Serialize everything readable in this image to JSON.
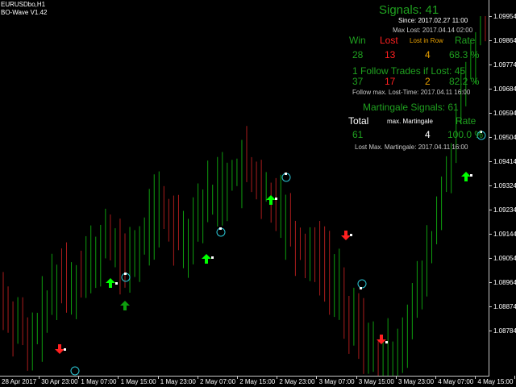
{
  "header": {
    "symbol": "EURUSDbo,H1",
    "indicator": "BO-Wave V1.42"
  },
  "price_axis": [
    "1.09954",
    "1.09864",
    "1.09774",
    "1.09684",
    "1.09594",
    "1.09504",
    "1.09414",
    "1.09324",
    "1.09234",
    "1.09144",
    "1.09054",
    "1.08964",
    "1.08874",
    "1.08784"
  ],
  "time_axis": [
    "28 Apr 2017",
    "30 Apr 23:00",
    "1 May 07:00",
    "1 May 15:00",
    "1 May 23:00",
    "2 May 07:00",
    "2 May 15:00",
    "2 May 23:00",
    "3 May 07:00",
    "3 May 15:00",
    "3 May 23:00",
    "4 May 07:00",
    "4 May 15:00"
  ],
  "stats": {
    "signals": "Signals: 41",
    "since": "Since: 2017.02.27 11:00",
    "max_lost": "Max Lost: 2017.04.14 02:00",
    "col_win": "Win",
    "col_lost": "Lost",
    "col_row": "Lost in Row",
    "col_rate": "Rate",
    "win": "28",
    "lost": "13",
    "row": "4",
    "rate": "68.3 %",
    "follow_title": "1 Follow Trades if Lost: 45",
    "f_win": "37",
    "f_lost": "17",
    "f_row": "2",
    "f_rate": "82.2 %",
    "follow_time": "Follow max. Lost-Time: 2017.04.11 16:00",
    "mart_title": "Martingale Signals: 61",
    "m_total_label": "Total",
    "m_max_label": "max. Martingale",
    "m_rate_label": "Rate",
    "m_total": "61",
    "m_max": "4",
    "m_rate": "100.0 %",
    "lost_mart": "Lost Max. Martingale: 2017.04.11 16:00"
  },
  "colors": {
    "green": "#1fa01f",
    "bright_green": "#00ff00",
    "red": "#ff2020",
    "orange": "#e8a000",
    "cyan": "#2bc7d6",
    "bear": "#aa1c1c",
    "bull": "#0e9e0e"
  }
}
